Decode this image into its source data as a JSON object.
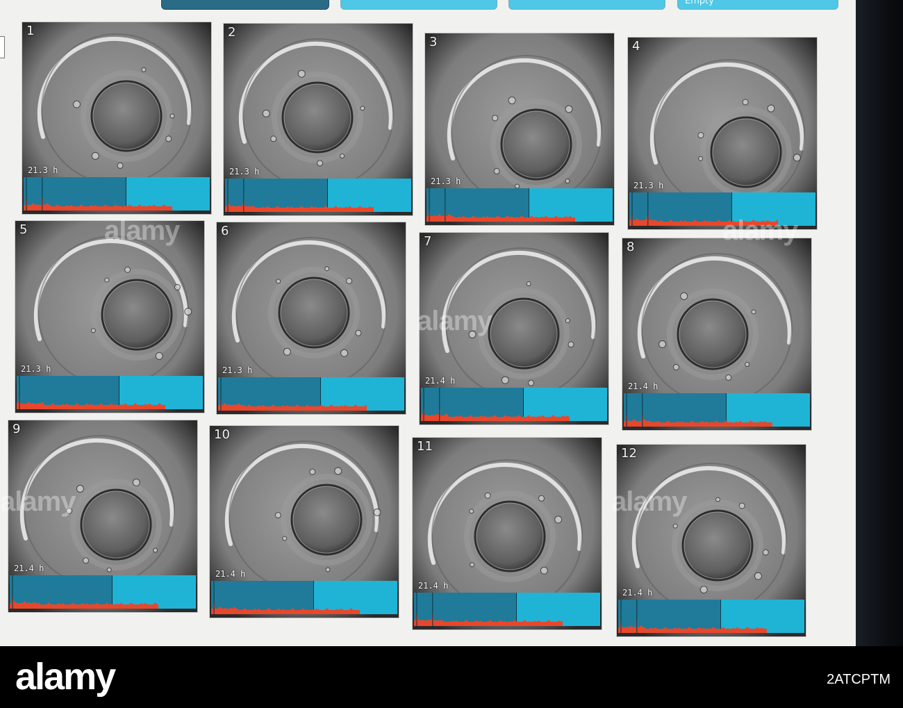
{
  "header": {
    "tabs": [
      {
        "label": ""
      },
      {
        "label": ""
      },
      {
        "label": ""
      },
      {
        "label": "Empty"
      }
    ]
  },
  "wells": [
    {
      "number": "1",
      "timestamp": "21.3 h",
      "spike_positions": [
        0.015,
        0.1
      ]
    },
    {
      "number": "2",
      "timestamp": "21.3 h",
      "spike_positions": [
        0.015,
        0.1
      ]
    },
    {
      "number": "3",
      "timestamp": "21.3 h",
      "spike_positions": [
        0.015,
        0.1
      ]
    },
    {
      "number": "4",
      "timestamp": "21.3 h",
      "spike_positions": [
        0.015,
        0.1
      ]
    },
    {
      "number": "5",
      "timestamp": "21.3 h",
      "spike_positions": [
        0.015
      ]
    },
    {
      "number": "6",
      "timestamp": "21.3 h",
      "spike_positions": [
        0.015
      ]
    },
    {
      "number": "7",
      "timestamp": "21.4 h",
      "spike_positions": [
        0.015,
        0.1
      ]
    },
    {
      "number": "8",
      "timestamp": "21.4 h",
      "spike_positions": [
        0.015,
        0.1
      ]
    },
    {
      "number": "9",
      "timestamp": "21.4 h",
      "spike_positions": [
        0.015
      ]
    },
    {
      "number": "10",
      "timestamp": "21.4 h",
      "spike_positions": [
        0.015
      ]
    },
    {
      "number": "11",
      "timestamp": "21.4 h",
      "spike_positions": [
        0.015,
        0.1
      ]
    },
    {
      "number": "12",
      "timestamp": "21.4 h",
      "spike_positions": [
        0.015,
        0.1
      ]
    }
  ],
  "colors": {
    "timeline_dark": "#1f7b99",
    "timeline_light": "#1fb4d6",
    "activity_trace": "#e8472c",
    "screen_bg": "#f1f2f0"
  },
  "watermark": {
    "brand": "alamy",
    "stock_code": "2ATCPTM"
  }
}
